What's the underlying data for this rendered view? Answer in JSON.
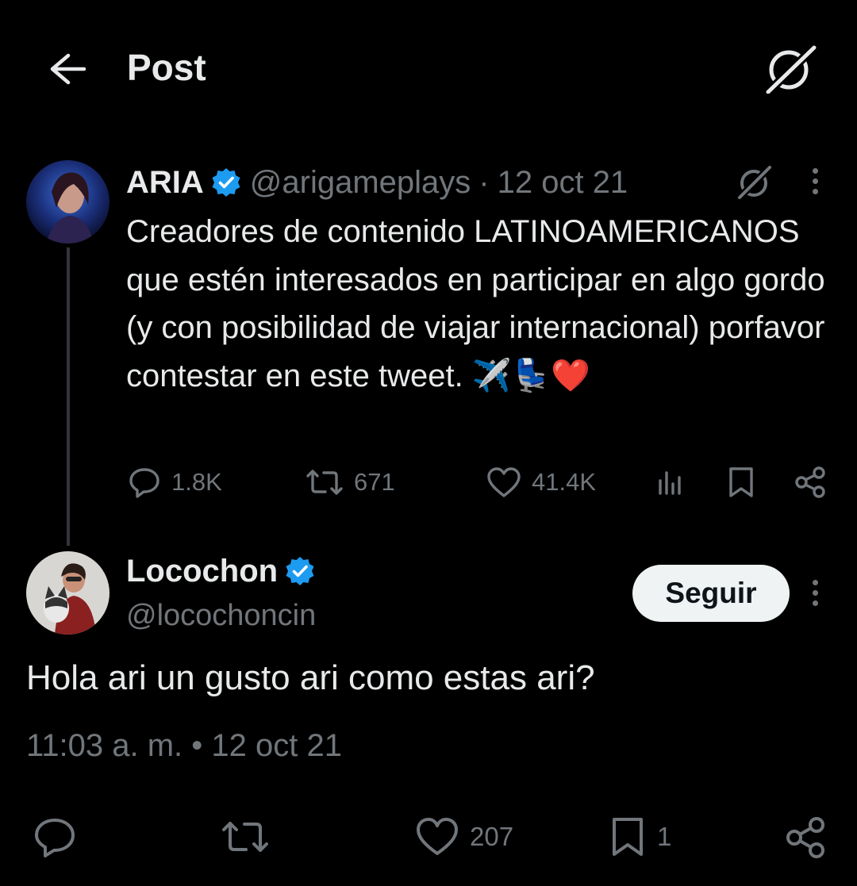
{
  "header": {
    "title": "Post",
    "back_icon": "arrow-left-icon",
    "grok_icon": "grok-icon"
  },
  "original_post": {
    "display_name": "ARIA",
    "verified": true,
    "handle": "@arigameplays",
    "separator": "·",
    "date": "12 oct 21",
    "text": "Creadores de contenido LATINOAMERICANOS que estén interesados en participar en algo gordo (y con posibilidad de viajar internacional) porfavor contestar en este tweet. ✈️💺❤️",
    "stats": {
      "replies": "1.8K",
      "reposts": "671",
      "likes": "41.4K"
    }
  },
  "reply_post": {
    "display_name": "Locochon",
    "verified": true,
    "handle": "@locochoncin",
    "follow_label": "Seguir",
    "text": "Hola ari un gusto ari como estas ari?",
    "timestamp": "11:03 a. m. • 12 oct 21",
    "stats": {
      "replies": "",
      "reposts": "",
      "likes": "207",
      "bookmarks": "1"
    }
  },
  "colors": {
    "background": "#000000",
    "text": "#e7e9ea",
    "muted": "#71767b",
    "verified": "#1d9bf0",
    "button_bg": "#eff3f4"
  }
}
